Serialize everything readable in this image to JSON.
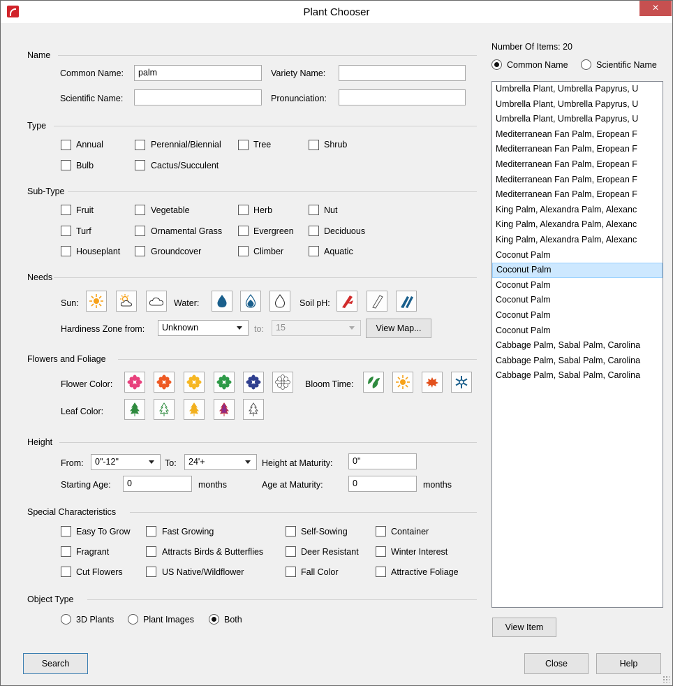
{
  "window": {
    "title": "Plant Chooser",
    "close_label": "×"
  },
  "name_section": {
    "heading": "Name",
    "common_name_label": "Common Name:",
    "common_name_value": "palm",
    "variety_name_label": "Variety Name:",
    "variety_name_value": "",
    "scientific_name_label": "Scientific Name:",
    "scientific_name_value": "",
    "pronunciation_label": "Pronunciation:",
    "pronunciation_value": ""
  },
  "type_section": {
    "heading": "Type",
    "options": [
      "Annual",
      "Perennial/Biennial",
      "Tree",
      "Shrub",
      "Bulb",
      "Cactus/Succulent"
    ]
  },
  "subtype_section": {
    "heading": "Sub-Type",
    "options": [
      "Fruit",
      "Vegetable",
      "Herb",
      "Nut",
      "Turf",
      "Ornamental Grass",
      "Evergreen",
      "Deciduous",
      "Houseplant",
      "Groundcover",
      "Climber",
      "Aquatic"
    ]
  },
  "needs_section": {
    "heading": "Needs",
    "sun_label": "Sun:",
    "water_label": "Water:",
    "soil_ph_label": "Soil pH:",
    "hardiness_label": "Hardiness Zone from:",
    "hardiness_from": "Unknown",
    "to_label": "to:",
    "hardiness_to": "15",
    "view_map_label": "View Map..."
  },
  "flowers_section": {
    "heading": "Flowers and Foliage",
    "flower_color_label": "Flower Color:",
    "bloom_time_label": "Bloom Time:",
    "leaf_color_label": "Leaf Color:",
    "flower_colors": [
      "#e8417d",
      "#ee5a24",
      "#f6b723",
      "#2e9a48",
      "#2f3f8f",
      "outline"
    ],
    "leaf_colors": [
      "#2e8a3e",
      "outline",
      "#f2b01e",
      "#8e2a8a",
      "outline"
    ]
  },
  "height_section": {
    "heading": "Height",
    "from_label": "From:",
    "from_value": "0\"-12\"",
    "to_label": "To:",
    "to_value": "24'+",
    "height_maturity_label": "Height at Maturity:",
    "height_maturity_value": "0\"",
    "starting_age_label": "Starting Age:",
    "starting_age_value": "0",
    "months_label": "months",
    "age_maturity_label": "Age at Maturity:",
    "age_maturity_value": "0",
    "months_label_2": "months"
  },
  "special_section": {
    "heading": "Special Characteristics",
    "options": [
      "Easy To Grow",
      "Fast Growing",
      "Self-Sowing",
      "Container",
      "Fragrant",
      "Attracts Birds & Butterflies",
      "Deer Resistant",
      "Winter Interest",
      "Cut Flowers",
      "US Native/Wildflower",
      "Fall Color",
      "Attractive Foliage"
    ]
  },
  "object_type_section": {
    "heading": "Object Type",
    "options": [
      "3D Plants",
      "Plant Images",
      "Both"
    ],
    "selected": "Both"
  },
  "results": {
    "count_label": "Number Of Items: 20",
    "sort_common": "Common Name",
    "sort_scientific": "Scientific Name",
    "sort_selected": "Common Name",
    "items": [
      "Umbrella Plant, Umbrella Papyrus, U",
      "Umbrella Plant, Umbrella Papyrus, U",
      "Umbrella Plant, Umbrella Papyrus, U",
      "Mediterranean Fan Palm, Eropean F",
      "Mediterranean Fan Palm, Eropean F",
      "Mediterranean Fan Palm, Eropean F",
      "Mediterranean Fan Palm, Eropean F",
      "Mediterranean Fan Palm, Eropean F",
      "King Palm, Alexandra Palm, Alexanc",
      "King Palm, Alexandra Palm, Alexanc",
      "King Palm, Alexandra Palm, Alexanc",
      "Coconut Palm",
      "Coconut Palm",
      "Coconut Palm",
      "Coconut Palm",
      "Coconut Palm",
      "Coconut Palm",
      "Cabbage Palm, Sabal Palm, Carolina",
      "Cabbage Palm, Sabal Palm, Carolina",
      "Cabbage Palm, Sabal Palm, Carolina"
    ],
    "selected_item": "Coconut Palm",
    "view_item_label": "View Item"
  },
  "buttons": {
    "search": "Search",
    "close": "Close",
    "help": "Help"
  }
}
